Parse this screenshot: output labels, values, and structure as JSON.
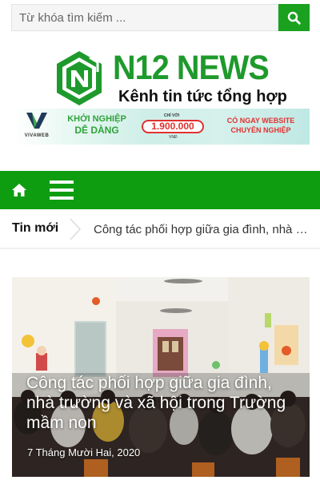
{
  "search": {
    "placeholder": "Từ khóa tìm kiếm ...",
    "button_icon": "search-icon"
  },
  "logo": {
    "title": "N12 NEWS",
    "tagline": "Kênh tin tức tổng hợp"
  },
  "banner": {
    "brand": "VIVAWEB",
    "left_line1": "KHỞI NGHIỆP",
    "left_line2": "DỄ DÀNG",
    "price_prefix": "CHỈ VỚI",
    "price": "1.900.000",
    "price_unit": "VNĐ",
    "right_line1": "CÓ NGAY WEBSITE",
    "right_line2": "CHUYÊN NGHIỆP"
  },
  "nav": {
    "home_icon": "home-icon",
    "menu_icon": "hamburger-menu-icon"
  },
  "ticker": {
    "label": "Tin mới",
    "headline": "Công tác phối hợp giữa gia đình, nhà trư..."
  },
  "featured": {
    "title": "Công tác phối hợp giữa gia đình, nhà trường và xã hội trong Trường mầm non",
    "date": "7 Tháng Mười Hai, 2020"
  },
  "colors": {
    "brand_green": "#0e9d10",
    "logo_green": "#1e9a2c",
    "accent_red": "#e13030"
  }
}
